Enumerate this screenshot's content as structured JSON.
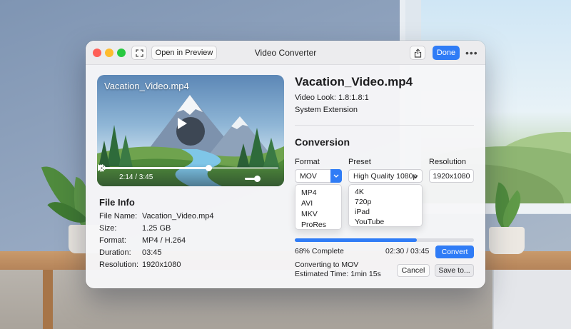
{
  "window": {
    "title": "Video Converter",
    "open_preview_label": "Open in Preview",
    "done_label": "Done",
    "more_label": "•••"
  },
  "player": {
    "video_title": "Vacation_Video.mp4",
    "time": "2:14 / 3:45",
    "progress_fraction": 0.6,
    "volume_fraction": 0.75
  },
  "file_info": {
    "heading": "File Info",
    "rows": [
      {
        "key": "File Name:",
        "value": "Vacation_Video.mp4"
      },
      {
        "key": "Size:",
        "value": "1.25 GB"
      },
      {
        "key": "Format:",
        "value": "MP4 / H.264"
      },
      {
        "key": "Duration:",
        "value": "03:45"
      },
      {
        "key": "Resolution:",
        "value": "1920x1080"
      }
    ]
  },
  "details": {
    "title": "Vacation_Video.mp4",
    "look": "Video Look: 1.8:1.8:1",
    "extension": "System Extension"
  },
  "conversion": {
    "heading": "Conversion",
    "format_label": "Format",
    "preset_label": "Preset",
    "resolution_label": "Resolution",
    "format_value": "MOV",
    "preset_value": "High Quality 1080p",
    "resolution_value": "1920x1080",
    "format_options": [
      "MP4",
      "AVI",
      "MKV",
      "ProRes"
    ],
    "preset_options": [
      "4K",
      "720p",
      "iPad",
      "YouTube"
    ],
    "progress_fraction": 0.68,
    "progress_text": "68% Complete",
    "time_text": "02:30 / 03:45",
    "convert_label": "Convert",
    "status_line": "Converting to MOV",
    "estimate_line": "Estimated Time: 1min 15s",
    "cancel_label": "Cancel",
    "save_label": "Save to..."
  },
  "colors": {
    "accent": "#2f7cf6",
    "close": "#fe5f57",
    "minimize": "#febc2e",
    "zoom": "#28c840"
  }
}
